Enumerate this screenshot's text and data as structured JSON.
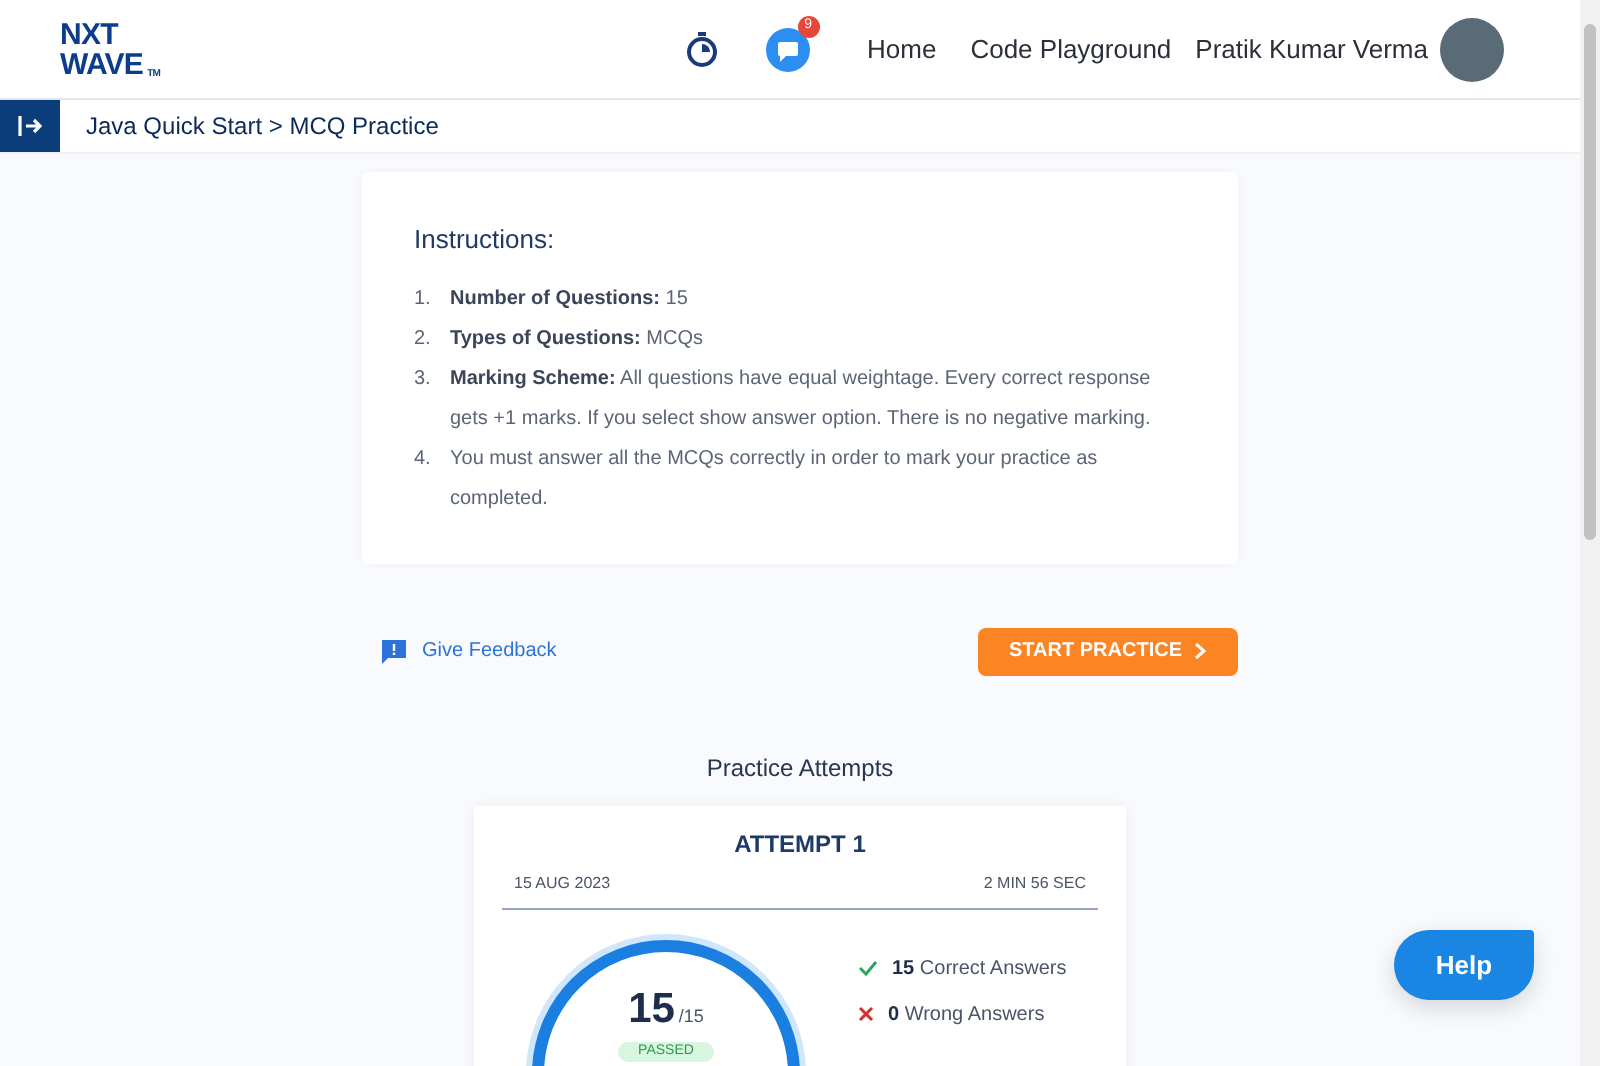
{
  "logo": {
    "line1": "NXT",
    "line2": "WAVE",
    "mark": "TM"
  },
  "header": {
    "notification_count": "9",
    "nav": [
      "Home",
      "Code Playground"
    ],
    "user_name": "Pratik Kumar Verma"
  },
  "breadcrumb": "Java Quick Start > MCQ Practice",
  "instructions": {
    "title": "Instructions:",
    "items": [
      {
        "number": "1.",
        "text": "**Number of Questions:** 15"
      },
      {
        "number": "2.",
        "text": "**Types of Questions:** MCQs"
      },
      {
        "number": "3.",
        "text": "**Marking Scheme:** All questions have equal weightage. Every correct response gets +1 marks. If you select show answer option. There is no negative marking."
      },
      {
        "number": "4.",
        "text": "You must answer all the MCQs correctly in order to mark your practice as completed."
      }
    ]
  },
  "feedback_link": "Give Feedback",
  "start_button": "START PRACTICE",
  "attempts": {
    "title": "Practice Attempts",
    "items": [
      {
        "title": "ATTEMPT 1",
        "date": "15 AUG 2023",
        "duration": "2 MIN 56 SEC",
        "score": "15",
        "total": "/15",
        "status": "PASSED",
        "results": [
          {
            "kind": "correct",
            "count": "15",
            "label": "Correct Answers"
          },
          {
            "kind": "wrong",
            "count": "0",
            "label": "Wrong Answers"
          }
        ]
      }
    ]
  },
  "help_button": "Help"
}
